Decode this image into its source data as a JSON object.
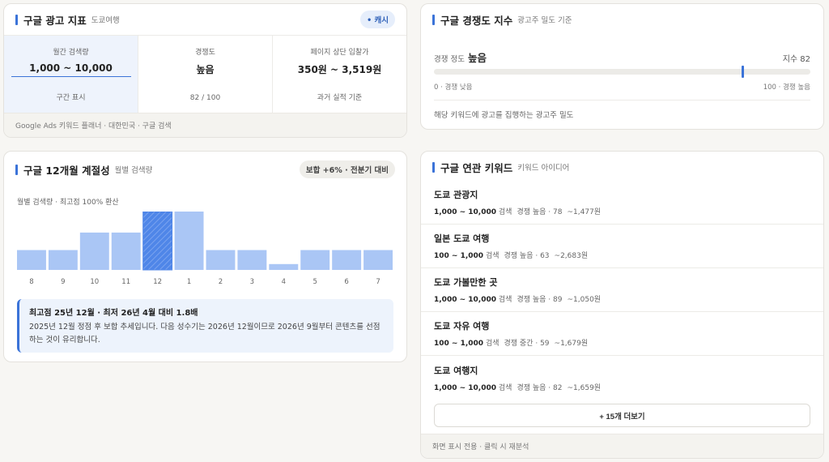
{
  "ad_metrics": {
    "title": "구글 광고 지표",
    "subtitle": "도쿄여행",
    "badge": "• 캐시",
    "metrics": [
      {
        "label": "월간 검색량",
        "value": "1,000 ~ 10,000",
        "foot": "구간 표시"
      },
      {
        "label": "경쟁도",
        "value": "높음",
        "foot": "82 / 100"
      },
      {
        "label": "페이지 상단 입찰가",
        "value": "350원 ~ 3,519원",
        "foot": "과거 실적 기준"
      }
    ],
    "footer": "Google Ads 키워드 플래너 · 대한민국 · 구글 검색"
  },
  "competition": {
    "title": "구글 경쟁도 지수",
    "subtitle": "광고주 밀도 기준",
    "label": "경쟁 정도",
    "value": "높음",
    "index_text": "지수 82",
    "index": 82,
    "low_label": "0 · 경쟁 낮음",
    "high_label": "100 · 경쟁 높음",
    "note": "해당 키워드에 광고를 집행하는 광고주 밀도"
  },
  "seasonality": {
    "title": "구글 12개월 계절성",
    "subtitle": "월별 검색량",
    "badge": "보합 +6% · 전분기 대비",
    "caption": "월별 검색량 · 최고점 100% 환산",
    "peak_title": "최고점 25년 12월 · 최저 26년 4월 대비 1.8배",
    "peak_body": "2025년 12월 정점 후 보합 추세입니다. 다음 성수기는 2026년 12월이므로 2026년 9월부터 콘텐츠를 선점하는 것이 유리합니다."
  },
  "chart_data": {
    "type": "bar",
    "categories": [
      "8",
      "9",
      "10",
      "11",
      "12",
      "1",
      "2",
      "3",
      "4",
      "5",
      "6",
      "7"
    ],
    "values": [
      34,
      34,
      64,
      64,
      100,
      100,
      34,
      34,
      10,
      34,
      34,
      34
    ],
    "highlight_index": 4,
    "ylim": [
      0,
      100
    ],
    "colors": {
      "bar": "#aac6f5",
      "highlight": "#4f86e8"
    }
  },
  "related": {
    "title": "구글 연관 키워드",
    "subtitle": "키워드 아이디어",
    "items": [
      {
        "name": "도쿄 관광지",
        "volume": "1,000 ~ 10,000",
        "search": "검색",
        "competition": "경쟁 높음 · 78",
        "bid": "~1,477원"
      },
      {
        "name": "일본 도쿄 여행",
        "volume": "100 ~ 1,000",
        "search": "검색",
        "competition": "경쟁 높음 · 63",
        "bid": "~2,683원"
      },
      {
        "name": "도쿄 가볼만한 곳",
        "volume": "1,000 ~ 10,000",
        "search": "검색",
        "competition": "경쟁 높음 · 89",
        "bid": "~1,050원"
      },
      {
        "name": "도쿄 자유 여행",
        "volume": "100 ~ 1,000",
        "search": "검색",
        "competition": "경쟁 중간 · 59",
        "bid": "~1,679원"
      },
      {
        "name": "도쿄 여행지",
        "volume": "1,000 ~ 10,000",
        "search": "검색",
        "competition": "경쟁 높음 · 82",
        "bid": "~1,659원"
      }
    ],
    "more_label": "+ 15개 더보기",
    "footer": "화면 표시 전용 · 클릭 시 재분석"
  },
  "colors": {
    "accent": "#3b73d8",
    "bar": "#aac6f5",
    "bar_highlight": "#4f86e8",
    "background": "#f7f6f3"
  }
}
